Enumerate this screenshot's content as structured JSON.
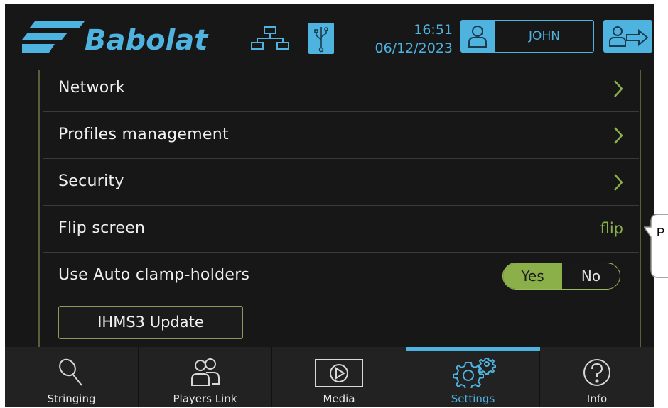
{
  "header": {
    "brand": "Babolat",
    "network_icon": "network-icon",
    "usb_icon": "usb-icon",
    "time": "16:51",
    "date": "06/12/2023",
    "user_icon": "user-icon",
    "user_name": "JOHN",
    "logout_icon": "user-logout-icon"
  },
  "settings": {
    "items": [
      {
        "label": "Network",
        "control": "chevron"
      },
      {
        "label": "Profiles management",
        "control": "chevron"
      },
      {
        "label": "Security",
        "control": "chevron"
      },
      {
        "label": "Flip screen",
        "control": "text",
        "value": "flip"
      },
      {
        "label": "Use Auto clamp-holders",
        "control": "toggle",
        "options": [
          "Yes",
          "No"
        ],
        "selected": "Yes"
      }
    ],
    "update_button": "IHMS3 Update"
  },
  "nav": {
    "tabs": [
      {
        "label": "Stringing",
        "icon": "racket-icon"
      },
      {
        "label": "Players Link",
        "icon": "players-icon"
      },
      {
        "label": "Media",
        "icon": "play-icon"
      },
      {
        "label": "Settings",
        "icon": "gears-icon",
        "active": true
      },
      {
        "label": "Info",
        "icon": "question-icon"
      }
    ]
  },
  "callout": {
    "text": "P"
  },
  "colors": {
    "accent_blue": "#4fb3e0",
    "accent_green": "#8bb04a",
    "background": "#171717"
  }
}
